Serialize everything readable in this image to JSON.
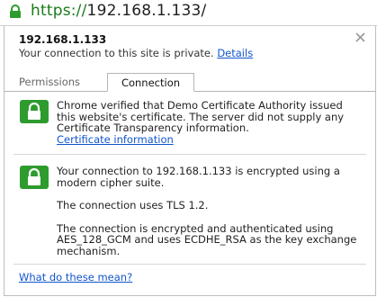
{
  "url_bar": {
    "scheme": "https://",
    "host": "192.168.1.133/"
  },
  "popup": {
    "host": "192.168.1.133",
    "private_text": "Your connection to this site is private.",
    "details_link": "Details",
    "tabs": [
      {
        "label": "Permissions"
      },
      {
        "label": "Connection"
      }
    ],
    "section1": {
      "text": "Chrome verified that Demo Certificate Authority issued this website's certificate. The server did not supply any Certificate Transparency information.",
      "link": "Certificate information"
    },
    "section2": {
      "line1": "Your connection to 192.168.1.133 is encrypted using a modern cipher suite.",
      "line2": "The connection uses TLS 1.2.",
      "line3": "The connection is encrypted and authenticated using AES_128_GCM and uses ECDHE_RSA as the key exchange mechanism."
    },
    "help_link": "What do these mean?"
  },
  "colors": {
    "lock_green": "#2e9b2e",
    "link_blue": "#1155cc",
    "https_green": "#1b7a1b"
  }
}
